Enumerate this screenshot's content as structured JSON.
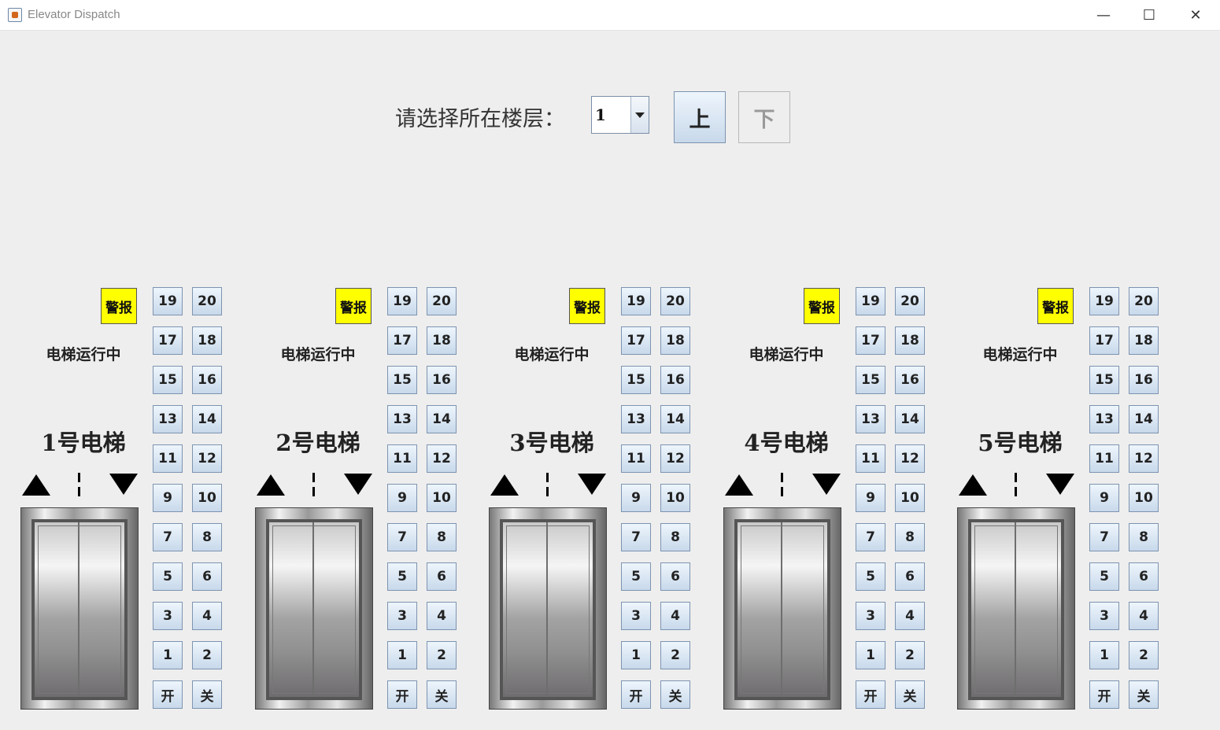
{
  "window": {
    "title": "Elevator Dispatch",
    "minimize": "—",
    "maximize": "☐",
    "close": "✕"
  },
  "control": {
    "floor_label": "请选择所在楼层：",
    "selected_floor": "1",
    "up_label": "上",
    "down_label": "下"
  },
  "elevators": [
    {
      "name": "1号电梯",
      "status": "电梯运行中",
      "alarm": "警报"
    },
    {
      "name": "2号电梯",
      "status": "电梯运行中",
      "alarm": "警报"
    },
    {
      "name": "3号电梯",
      "status": "电梯运行中",
      "alarm": "警报"
    },
    {
      "name": "4号电梯",
      "status": "电梯运行中",
      "alarm": "警报"
    },
    {
      "name": "5号电梯",
      "status": "电梯运行中",
      "alarm": "警报"
    }
  ],
  "keypad": {
    "rows": [
      [
        "19",
        "20"
      ],
      [
        "17",
        "18"
      ],
      [
        "15",
        "16"
      ],
      [
        "13",
        "14"
      ],
      [
        "11",
        "12"
      ],
      [
        "9",
        "10"
      ],
      [
        "7",
        "8"
      ],
      [
        "5",
        "6"
      ],
      [
        "3",
        "4"
      ],
      [
        "1",
        "2"
      ],
      [
        "开",
        "关"
      ]
    ]
  }
}
